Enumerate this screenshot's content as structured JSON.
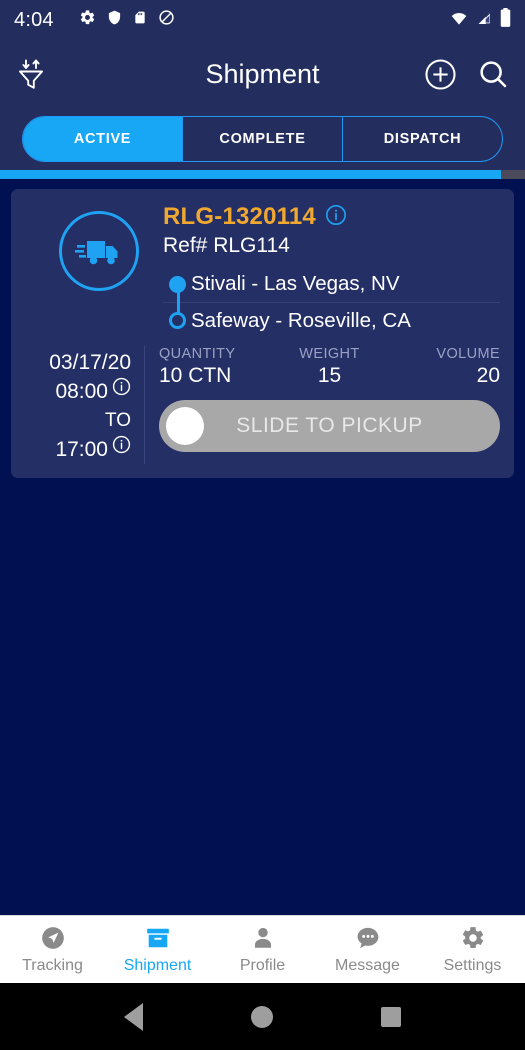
{
  "colors": {
    "page_bg": "#001050",
    "header_bg": "#232d5e",
    "card_bg": "#242f66",
    "accent_cyan": "#17a7f5",
    "accent_orange": "#f0a830",
    "slider_track": "#a8a8a8"
  },
  "statusbar": {
    "time": "4:04",
    "left_icons": [
      "gear-icon",
      "shield-icon",
      "sd-card-icon",
      "do-not-disturb-icon"
    ],
    "right_icons": [
      "wifi-icon",
      "cellular-signal-icon",
      "battery-icon"
    ]
  },
  "appbar": {
    "title": "Shipment",
    "filter_icon": "sort-filter-icon",
    "add_icon": "add-circle-icon",
    "search_icon": "search-icon"
  },
  "tabs": {
    "items": [
      {
        "label": "ACTIVE",
        "active": true
      },
      {
        "label": "COMPLETE",
        "active": false
      },
      {
        "label": "DISPATCH",
        "active": false
      }
    ]
  },
  "progress": {
    "percent": 95.5
  },
  "shipment": {
    "truck_icon": "delivery-truck-icon",
    "id": "RLG-1320114",
    "info_icon": "info-icon",
    "reference": "Ref# RLG114",
    "origin": "Stivali - Las Vegas, NV",
    "destination": "Safeway - Roseville, CA",
    "date": "03/17/20",
    "time_start": "08:00",
    "time_separator": "TO",
    "time_end": "17:00",
    "stats": [
      {
        "label": "QUANTITY",
        "value": "10 CTN"
      },
      {
        "label": "WEIGHT",
        "value": "15"
      },
      {
        "label": "VOLUME",
        "value": "20"
      }
    ],
    "slider_label": "SLIDE TO PICKUP"
  },
  "bottomnav": {
    "items": [
      {
        "label": "Tracking",
        "icon": "navigation-arrow-icon",
        "active": false
      },
      {
        "label": "Shipment",
        "icon": "box-icon",
        "active": true
      },
      {
        "label": "Profile",
        "icon": "person-icon",
        "active": false
      },
      {
        "label": "Message",
        "icon": "chat-bubble-icon",
        "active": false
      },
      {
        "label": "Settings",
        "icon": "gear-icon",
        "active": false
      }
    ]
  },
  "androidnav": {
    "back": "back-triangle-icon",
    "home": "home-circle-icon",
    "recents": "recents-square-icon"
  }
}
